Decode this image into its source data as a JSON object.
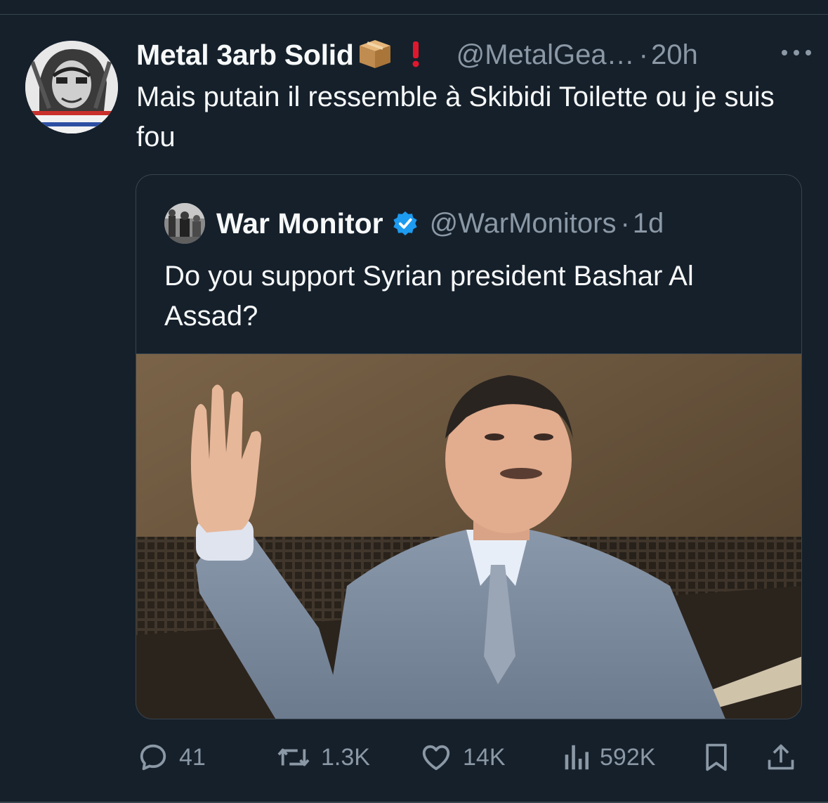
{
  "tweet": {
    "author_name": "Metal 3arb Solid",
    "author_emojis": "📦❗",
    "handle": "@MetalGea…",
    "separator": "·",
    "time": "20h",
    "text": "Mais putain il ressemble à Skibidi Toilette ou je suis fou"
  },
  "quoted_tweet": {
    "author_name": "War Monitor",
    "verified": true,
    "handle": "@WarMonitors",
    "separator": "·",
    "time": "1d",
    "text": "Do you support Syrian president Bashar Al Assad?"
  },
  "actions": {
    "replies": "41",
    "reposts": "1.3K",
    "likes": "14K",
    "views": "592K"
  },
  "icons": {
    "more": "more-horizontal-icon",
    "reply": "reply-bubble-icon",
    "repost": "repost-arrows-icon",
    "like": "heart-icon",
    "views": "analytics-bars-icon",
    "bookmark": "bookmark-icon",
    "share": "share-upload-icon",
    "verified": "verified-badge-icon"
  },
  "colors": {
    "background": "#15202b",
    "text": "#f7f9f9",
    "muted": "#8b98a5",
    "border": "#38444d",
    "verified_blue": "#1d9bf0"
  }
}
